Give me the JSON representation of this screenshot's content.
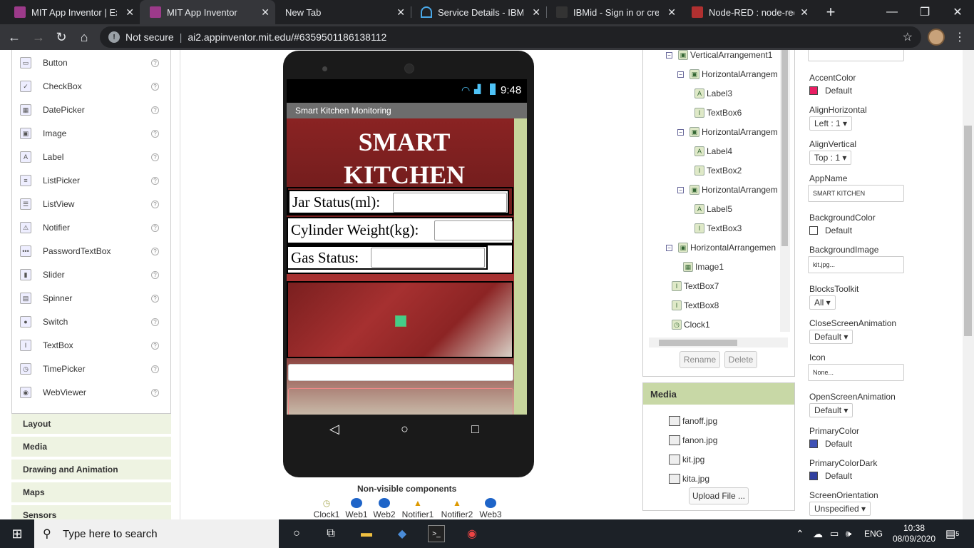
{
  "browser": {
    "tabs": [
      {
        "title": "MIT App Inventor | Expl",
        "active": false,
        "fav_color": "#9c3a8a"
      },
      {
        "title": "MIT App Inventor",
        "active": true,
        "fav_color": "#9c3a8a"
      },
      {
        "title": "New Tab",
        "active": false,
        "fav_color": ""
      },
      {
        "title": "Service Details - IBM Cl",
        "active": false,
        "fav_color": "#4aa8e8"
      },
      {
        "title": "IBMid - Sign in or creat",
        "active": false,
        "fav_color": "#333"
      },
      {
        "title": "Node-RED : node-red-e",
        "active": false,
        "fav_color": "#b03030"
      }
    ],
    "new_tab": "+",
    "address": {
      "security": "Not secure",
      "url": "ai2.appinventor.mit.edu/#6359501186138112"
    }
  },
  "palette": {
    "items": [
      "Button",
      "CheckBox",
      "DatePicker",
      "Image",
      "Label",
      "ListPicker",
      "ListView",
      "Notifier",
      "PasswordTextBox",
      "Slider",
      "Spinner",
      "Switch",
      "TextBox",
      "TimePicker",
      "WebViewer"
    ],
    "help": "?",
    "categories": [
      "Layout",
      "Media",
      "Drawing and Animation",
      "Maps",
      "Sensors"
    ]
  },
  "phone": {
    "time": "9:48",
    "app_title": "Smart Kitchen Monitoring",
    "heading_line1": "SMART",
    "heading_line2": "KITCHEN",
    "rows": [
      "Jar Status(ml):",
      "Cylinder Weight(kg):",
      "Gas Status:"
    ]
  },
  "nonvisible": {
    "title": "Non-visible components",
    "items": [
      "Clock1",
      "Web1",
      "Web2",
      "Notifier1",
      "Notifier2",
      "Web3"
    ]
  },
  "tree": {
    "nodes": [
      {
        "label": "VerticalArrangement1",
        "toggle": "⊖",
        "icon": "▣"
      },
      {
        "label": "HorizontalArrangem",
        "toggle": "⊖",
        "icon": "▣"
      },
      {
        "label": "Label3",
        "toggle": "",
        "icon": "A"
      },
      {
        "label": "TextBox6",
        "toggle": "",
        "icon": "I"
      },
      {
        "label": "HorizontalArrangem",
        "toggle": "⊖",
        "icon": "▣"
      },
      {
        "label": "Label4",
        "toggle": "",
        "icon": "A"
      },
      {
        "label": "TextBox2",
        "toggle": "",
        "icon": "I"
      },
      {
        "label": "HorizontalArrangem",
        "toggle": "⊖",
        "icon": "▣"
      },
      {
        "label": "Label5",
        "toggle": "",
        "icon": "A"
      },
      {
        "label": "TextBox3",
        "toggle": "",
        "icon": "I"
      },
      {
        "label": "HorizontalArrangemen",
        "toggle": "⊖",
        "icon": "▣"
      },
      {
        "label": "Image1",
        "toggle": "",
        "icon": "▦"
      },
      {
        "label": "TextBox7",
        "toggle": "",
        "icon": "I"
      },
      {
        "label": "TextBox8",
        "toggle": "",
        "icon": "I"
      },
      {
        "label": "Clock1",
        "toggle": "",
        "icon": "◷"
      }
    ],
    "rename": "Rename",
    "delete": "Delete"
  },
  "media": {
    "title": "Media",
    "files": [
      "fanoff.jpg",
      "fanon.jpg",
      "kit.jpg",
      "kita.jpg"
    ],
    "upload": "Upload File ..."
  },
  "properties": {
    "accent_label": "AccentColor",
    "accent_value": "Default",
    "accent_color": "#e91e63",
    "alignh_label": "AlignHorizontal",
    "alignh_value": "Left : 1",
    "alignv_label": "AlignVertical",
    "alignv_value": "Top : 1",
    "appname_label": "AppName",
    "appname_value": "SMART KITCHEN",
    "bgcolor_label": "BackgroundColor",
    "bgcolor_value": "Default",
    "bgcolor_color": "#ffffff",
    "bgimage_label": "BackgroundImage",
    "bgimage_value": "kit.jpg...",
    "blocks_label": "BlocksToolkit",
    "blocks_value": "All",
    "closeanim_label": "CloseScreenAnimation",
    "closeanim_value": "Default",
    "icon_label": "Icon",
    "icon_value": "None...",
    "openanim_label": "OpenScreenAnimation",
    "openanim_value": "Default",
    "primary_label": "PrimaryColor",
    "primary_value": "Default",
    "primary_color": "#3f51b5",
    "primarydark_label": "PrimaryColorDark",
    "primarydark_value": "Default",
    "primarydark_color": "#303f9f",
    "orient_label": "ScreenOrientation",
    "orient_value": "Unspecified"
  },
  "taskbar": {
    "search_placeholder": "Type here to search",
    "lang": "ENG",
    "time": "10:38",
    "date": "08/09/2020",
    "notifications": "5"
  }
}
